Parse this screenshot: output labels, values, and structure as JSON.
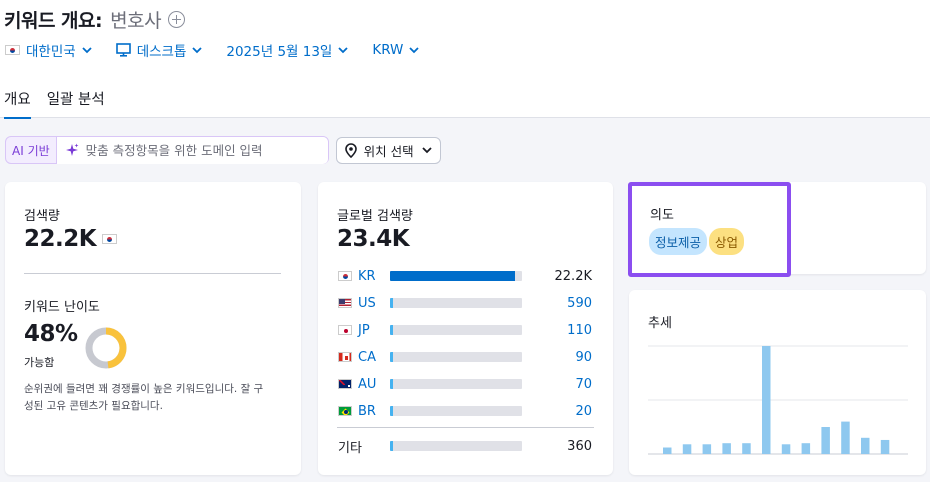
{
  "header": {
    "title": "키워드 개요:",
    "keyword": "변호사"
  },
  "filters": {
    "country": "대한민국",
    "device": "데스크톱",
    "date": "2025년 5월 13일",
    "currency": "KRW"
  },
  "tabs": [
    {
      "label": "개요",
      "active": true
    },
    {
      "label": "일괄 분석",
      "active": false
    }
  ],
  "ai_bar": {
    "label": "AI 기반",
    "placeholder": "맞춤 측정항목을 위한 도메인 입력",
    "location_label": "위치 선택"
  },
  "volume_card": {
    "label": "검색량",
    "value": "22.2K",
    "difficulty_label": "키워드 난이도",
    "difficulty_value": "48%",
    "difficulty_fraction": 0.48,
    "difficulty_level": "가능함",
    "description": "순위권에 들려면 꽤 경쟁률이 높은 키워드입니다. 잘 구성된 고유 콘텐츠가 필요합니다.",
    "description_line1": "순위권에 들려면 꽤 경쟁률이 높은 키워드입니다. 잘 구",
    "description_line2": "성된 고유 콘텐츠가 필요합니다.",
    "gauge_color": "#f9c23c",
    "gauge_track_color": "#c7c9d0"
  },
  "global_card": {
    "label": "글로벌 검색량",
    "value": "23.4K",
    "countries": [
      {
        "code": "KR",
        "value": "22.2K",
        "fraction": 0.95
      },
      {
        "code": "US",
        "value": "590",
        "fraction": 0.025
      },
      {
        "code": "JP",
        "value": "110",
        "fraction": 0.02
      },
      {
        "code": "CA",
        "value": "90",
        "fraction": 0.02
      },
      {
        "code": "AU",
        "value": "70",
        "fraction": 0.02
      },
      {
        "code": "BR",
        "value": "20",
        "fraction": 0.02
      }
    ],
    "other": {
      "label": "기타",
      "value": "360",
      "fraction": 0.02
    }
  },
  "intent_card": {
    "label": "의도",
    "badges": [
      {
        "label": "정보제공",
        "bg": "#c4e5fe",
        "color": "#0b5fa8"
      },
      {
        "label": "상업",
        "bg": "#fce081",
        "color": "#8a5a00"
      }
    ]
  },
  "trend_card": {
    "label": "추세",
    "bar_color": "#8ec8ef",
    "values": [
      0.06,
      0.09,
      0.09,
      0.1,
      0.1,
      1.0,
      0.09,
      0.1,
      0.25,
      0.3,
      0.15,
      0.13
    ]
  },
  "colors": {
    "accent": "#006dca",
    "highlight": "#8b4ef0"
  }
}
